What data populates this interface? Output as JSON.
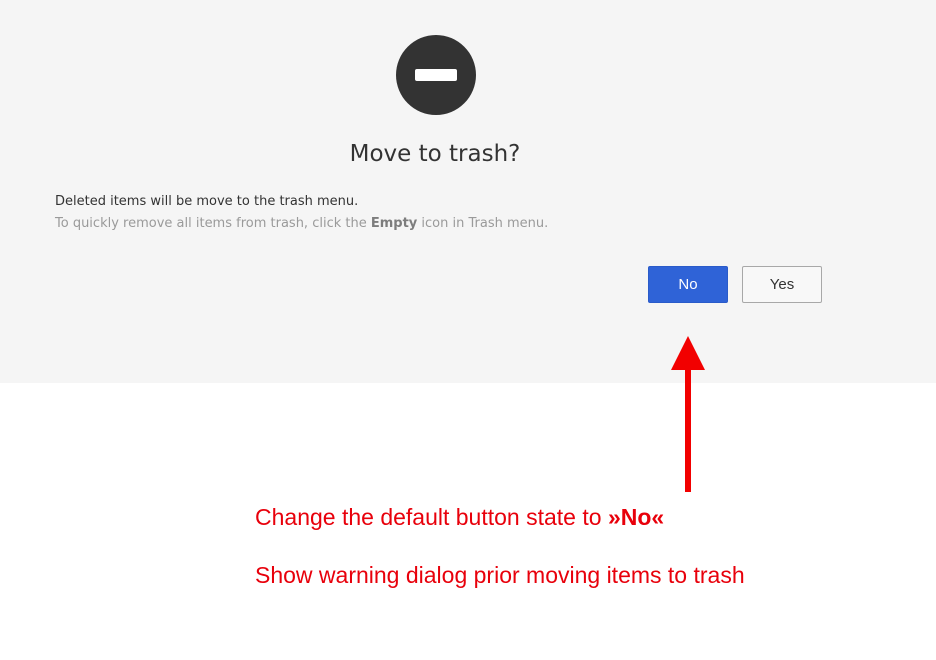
{
  "dialog": {
    "title": "Move to trash?",
    "message": "Deleted items will be move to the trash menu.",
    "hint_prefix": "To quickly remove all items from trash, click the ",
    "hint_emphasis": "Empty",
    "hint_suffix": " icon in Trash menu.",
    "icon": "minus-circle-icon",
    "buttons": {
      "no_label": "No",
      "yes_label": "Yes"
    }
  },
  "annotations": {
    "line1_prefix": "Change the default button state to ",
    "line1_emphasis": "»No«",
    "line2": "Show warning dialog prior moving items to trash",
    "arrow_icon": "arrow-up-icon",
    "color": "#e8000b"
  },
  "colors": {
    "primary_button": "#2f63d7",
    "dialog_background": "#f5f5f5",
    "icon_background": "#333333"
  }
}
